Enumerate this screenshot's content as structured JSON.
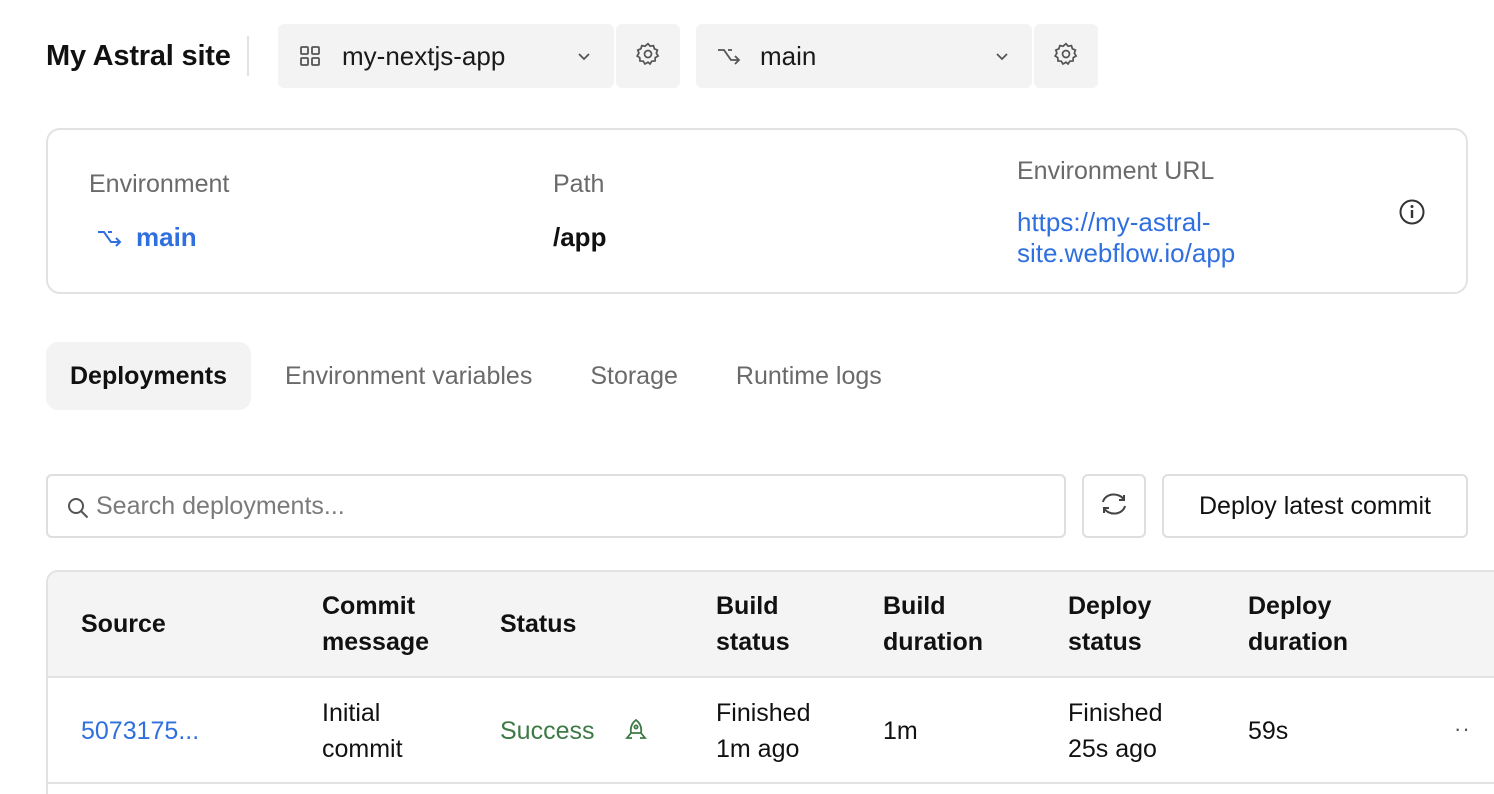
{
  "header": {
    "site_title": "My Astral site",
    "app_select": {
      "value": "my-nextjs-app",
      "icon": "grid-icon"
    },
    "branch_select": {
      "value": "main",
      "icon": "branch-icon"
    }
  },
  "environment": {
    "env_label": "Environment",
    "env_value": "main",
    "path_label": "Path",
    "path_value": "/app",
    "url_label": "Environment URL",
    "url_line1": "https://my-astral-",
    "url_line2": "site.webflow.io/app"
  },
  "tabs": [
    {
      "label": "Deployments",
      "active": true
    },
    {
      "label": "Environment variables",
      "active": false
    },
    {
      "label": "Storage",
      "active": false
    },
    {
      "label": "Runtime logs",
      "active": false
    }
  ],
  "toolbar": {
    "search_placeholder": "Search deployments...",
    "deploy_label": "Deploy latest commit"
  },
  "table": {
    "columns": [
      {
        "line1": "Source",
        "line2": ""
      },
      {
        "line1": "Commit",
        "line2": "message"
      },
      {
        "line1": "Status",
        "line2": ""
      },
      {
        "line1": "Build",
        "line2": "status"
      },
      {
        "line1": "Build",
        "line2": "duration"
      },
      {
        "line1": "Deploy",
        "line2": "status"
      },
      {
        "line1": "Deploy",
        "line2": "duration"
      }
    ],
    "rows": [
      {
        "source": "5073175...",
        "commit_line1": "Initial",
        "commit_line2": "commit",
        "status": "Success",
        "build_status_line1": "Finished",
        "build_status_line2": "1m ago",
        "build_duration": "1m",
        "deploy_status_line1": "Finished",
        "deploy_status_line2": "25s ago",
        "deploy_duration": "59s",
        "more": "··"
      }
    ]
  },
  "colors": {
    "link": "#2f6fde",
    "success": "#3d7a45",
    "surface": "#f3f3f3",
    "border": "#e2e2e2"
  }
}
